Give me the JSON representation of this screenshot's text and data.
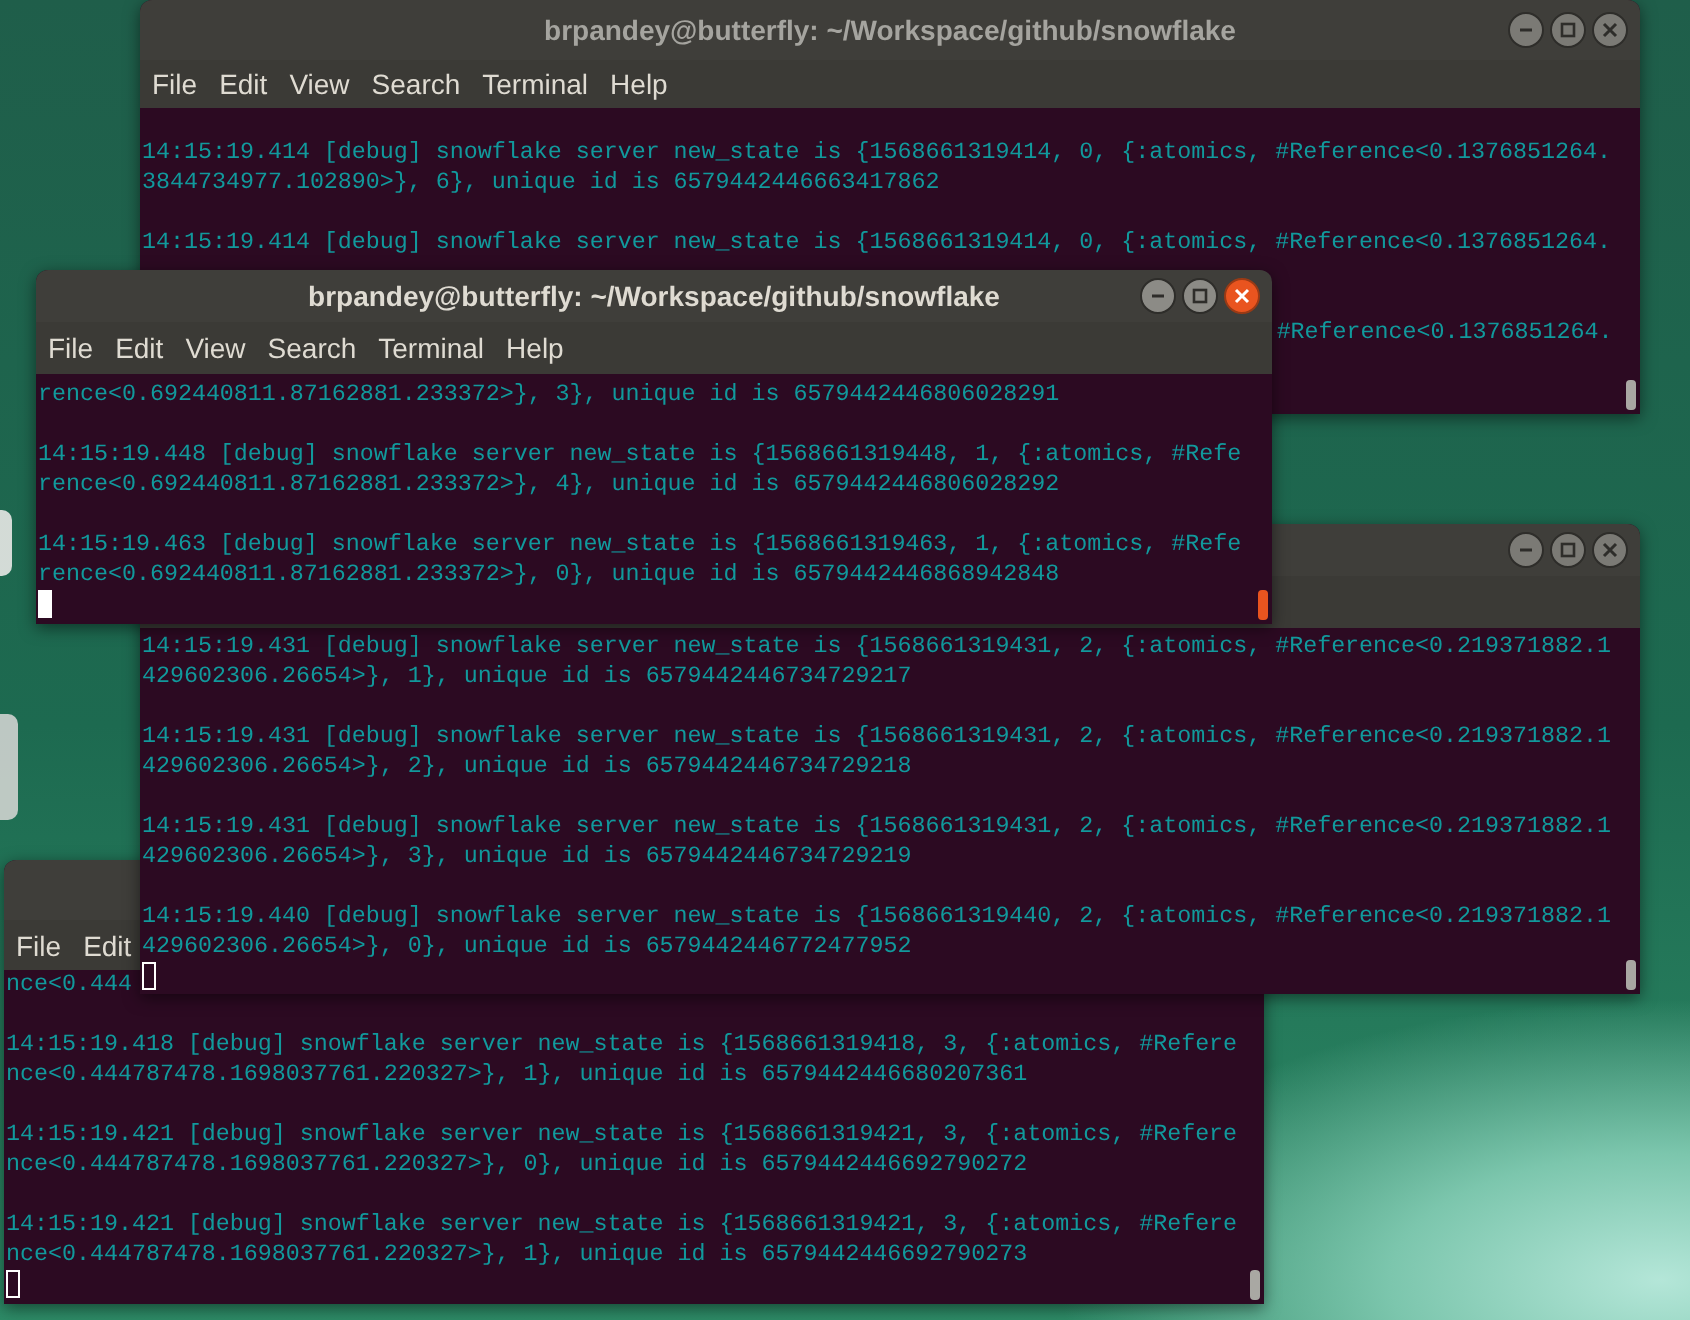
{
  "windows": [
    {
      "title": "brpandey@butterfly: ~/Workspace/github/snowflake",
      "focused": false,
      "window_buttons": true,
      "menu": [
        "File",
        "Edit",
        "View",
        "Search",
        "Terminal",
        "Help"
      ],
      "lines": [
        {
          "kind": "blank"
        },
        {
          "kind": "text",
          "text": "14:15:19.414 [debug] snowflake server new_state is {1568661319414, 0, {:atomics, #Reference<0.1376851264."
        },
        {
          "kind": "text",
          "text": "3844734977.102890>}, 6}, unique id is 6579442446663417862"
        },
        {
          "kind": "blank"
        },
        {
          "kind": "text",
          "text": "14:15:19.414 [debug] snowflake server new_state is {1568661319414, 0, {:atomics, #Reference<0.1376851264."
        },
        {
          "kind": "blank"
        },
        {
          "kind": "blank"
        },
        {
          "kind": "tail",
          "text": "#Reference<0.1376851264."
        }
      ]
    },
    {
      "title": "brpandey@butterfly: ~/Workspace/github/snowflake",
      "focused": true,
      "window_buttons": true,
      "menu": [
        "File",
        "Edit",
        "View",
        "Search",
        "Terminal",
        "Help"
      ],
      "lines": [
        {
          "kind": "text",
          "text": "rence<0.692440811.87162881.233372>}, 3}, unique id is 6579442446806028291"
        },
        {
          "kind": "blank"
        },
        {
          "kind": "text",
          "text": "14:15:19.448 [debug] snowflake server new_state is {1568661319448, 1, {:atomics, #Refe"
        },
        {
          "kind": "text",
          "text": "rence<0.692440811.87162881.233372>}, 4}, unique id is 6579442446806028292"
        },
        {
          "kind": "blank"
        },
        {
          "kind": "text",
          "text": "14:15:19.463 [debug] snowflake server new_state is {1568661319463, 1, {:atomics, #Refe"
        },
        {
          "kind": "text",
          "text": "rence<0.692440811.87162881.233372>}, 0}, unique id is 6579442446868942848"
        },
        {
          "kind": "cursor"
        }
      ]
    },
    {
      "focused": false,
      "window_buttons": true,
      "lines": [
        {
          "kind": "text",
          "text": "14:15:19.431 [debug] snowflake server new_state is {1568661319431, 2, {:atomics, #Reference<0.219371882.1"
        },
        {
          "kind": "text",
          "text": "429602306.26654>}, 1}, unique id is 6579442446734729217"
        },
        {
          "kind": "blank"
        },
        {
          "kind": "text",
          "text": "14:15:19.431 [debug] snowflake server new_state is {1568661319431, 2, {:atomics, #Reference<0.219371882.1"
        },
        {
          "kind": "text",
          "text": "429602306.26654>}, 2}, unique id is 6579442446734729218"
        },
        {
          "kind": "blank"
        },
        {
          "kind": "text",
          "text": "14:15:19.431 [debug] snowflake server new_state is {1568661319431, 2, {:atomics, #Reference<0.219371882.1"
        },
        {
          "kind": "text",
          "text": "429602306.26654>}, 3}, unique id is 6579442446734729219"
        },
        {
          "kind": "blank"
        },
        {
          "kind": "text",
          "text": "14:15:19.440 [debug] snowflake server new_state is {1568661319440, 2, {:atomics, #Reference<0.219371882.1"
        },
        {
          "kind": "text",
          "text": "429602306.26654>}, 0}, unique id is 6579442446772477952"
        },
        {
          "kind": "cursor"
        }
      ]
    },
    {
      "focused": false,
      "menu": [
        "File",
        "Edit"
      ],
      "lines": [
        {
          "kind": "text",
          "text": "nce<0.444"
        },
        {
          "kind": "blank"
        },
        {
          "kind": "text",
          "text": "14:15:19.418 [debug] snowflake server new_state is {1568661319418, 3, {:atomics, #Refere"
        },
        {
          "kind": "text",
          "text": "nce<0.444787478.1698037761.220327>}, 1}, unique id is 6579442446680207361"
        },
        {
          "kind": "blank"
        },
        {
          "kind": "text",
          "text": "14:15:19.421 [debug] snowflake server new_state is {1568661319421, 3, {:atomics, #Refere"
        },
        {
          "kind": "text",
          "text": "nce<0.444787478.1698037761.220327>}, 0}, unique id is 6579442446692790272"
        },
        {
          "kind": "blank"
        },
        {
          "kind": "text",
          "text": "14:15:19.421 [debug] snowflake server new_state is {1568661319421, 3, {:atomics, #Refere"
        },
        {
          "kind": "text",
          "text": "nce<0.444787478.1698037761.220327>}, 1}, unique id is 6579442446692790273"
        },
        {
          "kind": "cursor"
        }
      ]
    }
  ]
}
